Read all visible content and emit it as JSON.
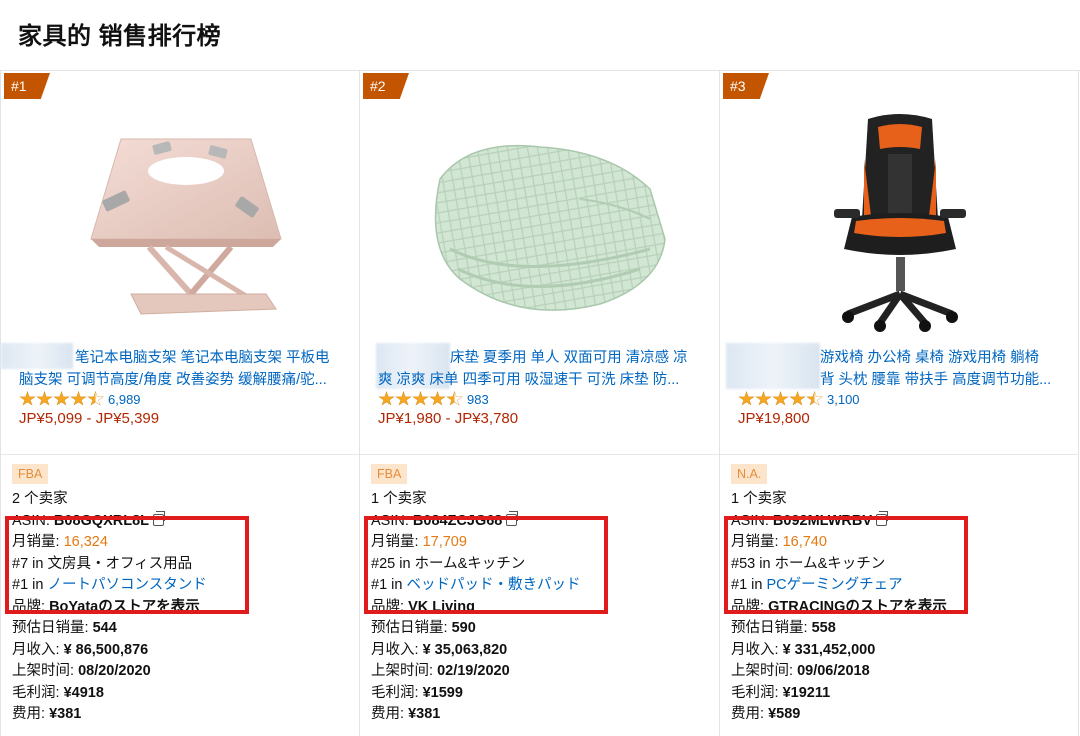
{
  "page": {
    "title": "家具的 销售排行榜"
  },
  "labels": {
    "sellers_suffix": " 个卖家",
    "asin": "ASIN: ",
    "monthly_sales": "月销量: ",
    "in": " in ",
    "brand": "品牌: ",
    "daily_sales": "预估日销量: ",
    "monthly_revenue": "月收入: ",
    "listed_date": "上架时间: ",
    "gross_profit": "毛利润: ",
    "fee": "费用: "
  },
  "colors": {
    "rank_badge": "#c45500",
    "link": "#0066c0",
    "price": "#b12704",
    "highlight_box": "#e01b1b",
    "orange": "#e47911"
  },
  "products": [
    {
      "rank": "#1",
      "image_icon": "laptop-stand-image",
      "title_line1": "笔记本电脑支架 笔记本电脑支架 平板电",
      "title_line2": "脑支架 可调节高度/角度 改善姿势 缓解腰痛/驼...",
      "rating_stars": 4.5,
      "rating_count": "6,989",
      "price": "JP¥5,099 - JP¥5,399",
      "fulfillment": "FBA",
      "seller_count": "2",
      "asin": "B08GQXRL8L",
      "monthly_sales": "16,324",
      "rank_line1": "#7 in 文房具・オフィス用品",
      "rank_line2_prefix": "#1",
      "rank_line2_category": "ノートパソコンスタンド",
      "brand": "BoYataのストアを表示",
      "daily_sales": "544",
      "monthly_revenue": "¥ 86,500,876",
      "listed_date": "08/20/2020",
      "gross_profit": "¥4918",
      "fee": "¥381"
    },
    {
      "rank": "#2",
      "image_icon": "cooling-mattress-pad-image",
      "title_line1": "床垫 夏季用 单人 双面可用 清凉感 凉",
      "title_line2": "爽 凉爽 床单 四季可用 吸湿速干 可洗 床垫 防...",
      "rating_stars": 4.5,
      "rating_count": "983",
      "price": "JP¥1,980 - JP¥3,780",
      "fulfillment": "FBA",
      "seller_count": "1",
      "asin": "B084ZCJG68",
      "monthly_sales": "17,709",
      "rank_line1": "#25 in ホーム&キッチン",
      "rank_line2_prefix": "#1",
      "rank_line2_category": "ベッドパッド・敷きパッド",
      "brand": "VK Living",
      "daily_sales": "590",
      "monthly_revenue": "¥ 35,063,820",
      "listed_date": "02/19/2020",
      "gross_profit": "¥1599",
      "fee": "¥381"
    },
    {
      "rank": "#3",
      "image_icon": "gaming-chair-image",
      "title_line1": "游戏椅 办公椅 桌椅 游戏用椅 躺椅",
      "title_line2": "背 头枕 腰靠 带扶手 高度调节功能...",
      "rating_stars": 4.5,
      "rating_count": "3,100",
      "price": "JP¥19,800",
      "fulfillment": "N.A.",
      "seller_count": "1",
      "asin": "B092MLWRBV",
      "monthly_sales": "16,740",
      "rank_line1": "#53 in ホーム&キッチン",
      "rank_line2_prefix": "#1",
      "rank_line2_category": "PCゲーミングチェア",
      "brand": "GTRACINGのストアを表示",
      "daily_sales": "558",
      "monthly_revenue": "¥ 331,452,000",
      "listed_date": "09/06/2018",
      "gross_profit": "¥19211",
      "fee": "¥589"
    }
  ]
}
